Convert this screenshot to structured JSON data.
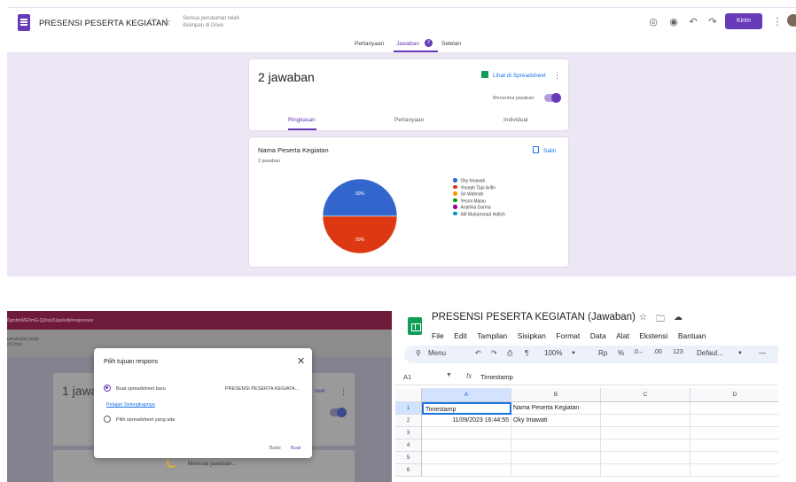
{
  "forms": {
    "title": "PRESENSI PESERTA KEGIATAN",
    "save_status": "Semua perubahan telah disimpan di Drive",
    "send_label": "Kirim",
    "tabs": [
      {
        "label": "Pertanyaan"
      },
      {
        "label": "Jawaban"
      },
      {
        "label": "Setelan"
      }
    ],
    "responses_badge": "2",
    "summary_card": {
      "count_label": "2 jawaban",
      "sheet_link": "Lihat di Spreadsheet",
      "accept_label": "Menerima jawaban",
      "subtabs": [
        "Ringkasan",
        "Pertanyaan",
        "Individual"
      ]
    },
    "question_card": {
      "title": "Nama Peserta Kegiatan",
      "count": "2 jawaban",
      "copy_label": "Salin"
    }
  },
  "chart_data": {
    "type": "pie",
    "slices": [
      {
        "label": "Oky Imawati",
        "value": 50,
        "color": "#3366cc"
      },
      {
        "label": "Yoseph Tapi Arifin",
        "value": 50,
        "color": "#dc3912"
      },
      {
        "label": "Sri Wahnah",
        "value": 0,
        "color": "#ff9900"
      },
      {
        "label": "Yesmi Malau",
        "value": 0,
        "color": "#109618"
      },
      {
        "label": "Anjelina Darma",
        "value": 0,
        "color": "#990099"
      },
      {
        "label": "Alif Muhammad Hafizh",
        "value": 0,
        "color": "#0099c6"
      }
    ],
    "data_labels": [
      "50%",
      "50%"
    ]
  },
  "dialog": {
    "url": "6gmbnWEDmG-Qj3np2Upp/edit#responses",
    "status": "perubahan telah di Drive",
    "bg_count": "1 jawa",
    "bg_link": "heet",
    "loading_label": "Memuat jawaban...",
    "title": "Pilih tujuan respons",
    "option_new": "Buat spreadsheet baru",
    "new_sheet_name": "PRESENSI PESERTA KEGIATA...",
    "learn_more": "Pelajari Selengkapnya",
    "option_existing": "Pilih spreadsheet yang ada",
    "cancel_label": "Batal",
    "create_label": "Buat"
  },
  "sheets": {
    "title": "PRESENSI PESERTA KEGIATAN (Jawaban)",
    "menus": [
      "File",
      "Edit",
      "Tampilan",
      "Sisipkan",
      "Format",
      "Data",
      "Alat",
      "Ekstensi",
      "Bantuan"
    ],
    "toolbar": {
      "menu_label": "Menu",
      "zoom": "100%",
      "currency": "Rp",
      "percent": "%",
      "dec_less": ".0←",
      "dec_more": ".00",
      "number_fmt": "123",
      "font": "Defaul...",
      "minus": "—"
    },
    "cell_ref": "A1",
    "formula": "Timestamp",
    "columns": [
      "A",
      "B",
      "C",
      "D"
    ],
    "rows": [
      "1",
      "2",
      "3",
      "4",
      "5",
      "6"
    ],
    "cells": [
      [
        "Timestamp",
        "Nama Peserta Kegiatan",
        "",
        ""
      ],
      [
        "11/09/2023 16:44:55",
        "Oky Imawati",
        "",
        ""
      ]
    ]
  }
}
